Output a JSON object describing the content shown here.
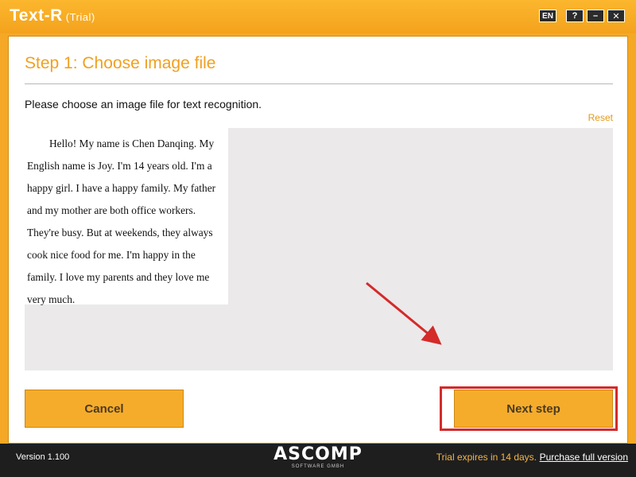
{
  "app": {
    "title": "Text-R",
    "subtitle": "(Trial)"
  },
  "window_controls": {
    "language": "EN",
    "help": "?",
    "minimize": "–",
    "close": "✕"
  },
  "step": {
    "title": "Step 1: Choose image file",
    "instruction": "Please choose an image file for text recognition.",
    "reset_label": "Reset"
  },
  "preview": {
    "paragraph": "Hello! My name is Chen Danqing. My English name is Joy. I'm 14 years old. I'm a happy girl. I have a happy family. My father and my mother are both office workers. They're busy. But at weekends, they always cook nice food for me. I'm happy in the family. I love my parents and they love me very much."
  },
  "buttons": {
    "cancel": "Cancel",
    "next": "Next step"
  },
  "footer": {
    "version": "Version 1.100",
    "logo": "ASCOMP",
    "logo_sub": "SOFTWARE GMBH",
    "trial_notice": "Trial expires in 14 days.",
    "purchase": "Purchase full version"
  },
  "colors": {
    "accent": "#f5a825",
    "annotation_red": "#d42a2a"
  }
}
